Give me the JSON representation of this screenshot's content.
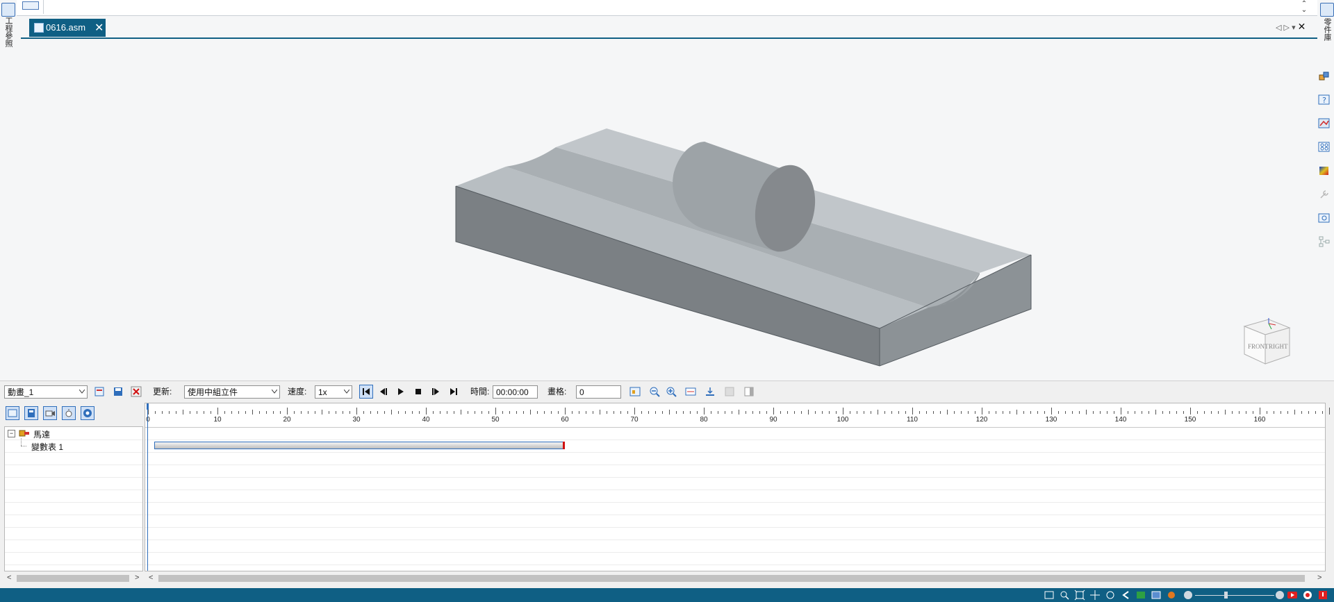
{
  "left_dock": {
    "label": "工程參照",
    "icon": "pathfinder-icon"
  },
  "right_dock": {
    "label": "零件庫",
    "icon": "library-icon"
  },
  "document_tab": {
    "label": "0616.asm",
    "close_glyph": "✕",
    "icon": "assembly-file-icon"
  },
  "tab_nav": {
    "prev": "◁",
    "next": "▷",
    "menu": "▾",
    "close": "✕"
  },
  "viewcube": {
    "front_label": "FRONT",
    "right_label": "RIGHT"
  },
  "toolbar": {
    "animation_name": "動畫_1",
    "update_label": "更新:",
    "update_value": "使用中組立件",
    "speed_label": "速度:",
    "speed_value": "1x",
    "time_label": "時間:",
    "time_value": "00:00:00",
    "frame_label": "畫格:",
    "frame_value": "0"
  },
  "tree": {
    "items": [
      {
        "label": "馬達",
        "icon": "motor-icon",
        "expander": "−"
      },
      {
        "label": "變數表 1"
      }
    ]
  },
  "timeline": {
    "ticks": [
      0,
      10,
      20,
      30,
      40,
      50,
      60,
      70,
      80,
      90,
      100,
      110,
      120,
      130,
      140,
      150,
      160
    ],
    "bar_start": 0,
    "bar_end": 60
  },
  "scroll_arrows": {
    "left": "<",
    "right": ">"
  },
  "colors": {
    "accent": "#0f5f84",
    "bar_end_marker": "#d01010",
    "tab_active": "#0f5f84"
  }
}
